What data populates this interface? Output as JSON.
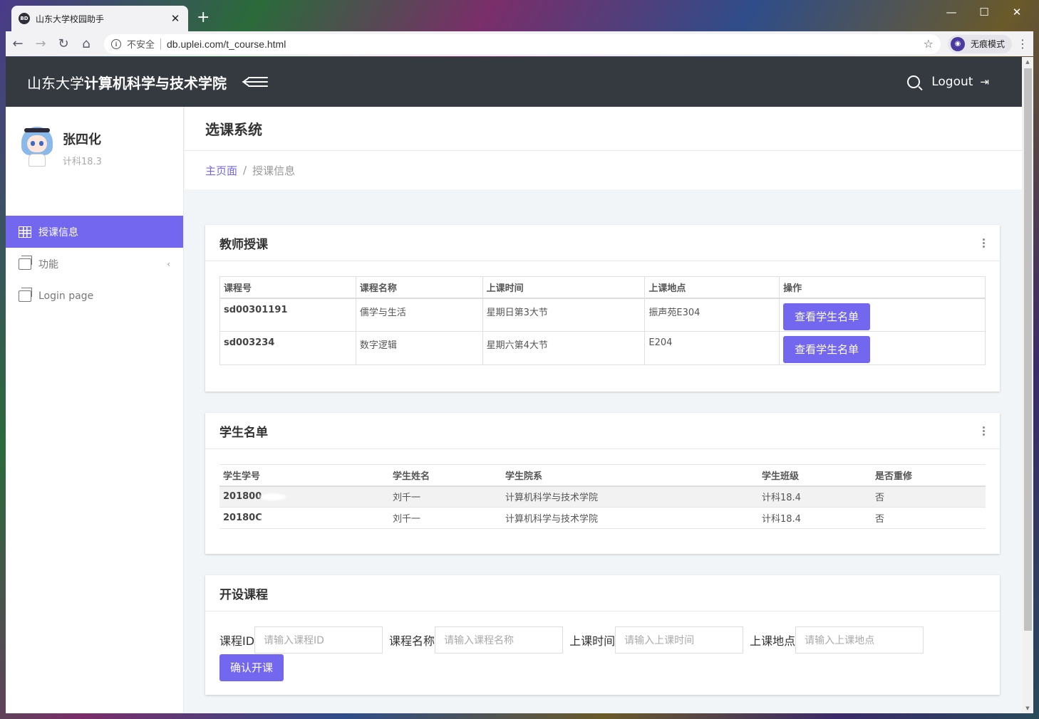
{
  "browser": {
    "tab_title": "山东大学校园助手",
    "favicon_text": "BD",
    "insecure_label": "不安全",
    "url": "db.uplei.com/t_course.html",
    "incognito_label": "无痕模式"
  },
  "topbar": {
    "brand_prefix": "山东大学",
    "brand_bold": "计算机科学与技术学院",
    "logout_label": "Logout"
  },
  "user": {
    "name": "张四化",
    "class": "计科18.3"
  },
  "sidebar": {
    "items": [
      {
        "label": "授课信息",
        "icon": "grid-icon",
        "active": true
      },
      {
        "label": "功能",
        "icon": "copy-icon",
        "has_submenu": true
      },
      {
        "label": "Login page",
        "icon": "copy-icon"
      }
    ]
  },
  "page": {
    "title": "选课系统",
    "breadcrumb_home": "主页面",
    "breadcrumb_current": "授课信息"
  },
  "teaching": {
    "title": "教师授课",
    "headers": [
      "课程号",
      "课程名称",
      "上课时间",
      "上课地点",
      "操作"
    ],
    "rows": [
      {
        "id": "sd00301191",
        "name": "儒学与生活",
        "time": "星期日第3大节",
        "place": "振声苑E304",
        "action": "查看学生名单"
      },
      {
        "id": "sd003234",
        "name": "数字逻辑",
        "time": "星期六第4大节",
        "place": "E204",
        "action": "查看学生名单"
      }
    ]
  },
  "students": {
    "title": "学生名单",
    "headers": [
      "学生学号",
      "学生姓名",
      "学生院系",
      "学生班级",
      "是否重修"
    ],
    "rows": [
      {
        "id": "201800",
        "name": "刘千一",
        "dept": "计算机科学与技术学院",
        "class": "计科18.4",
        "retake": "否"
      },
      {
        "id": "20180C",
        "name": "刘千一",
        "dept": "计算机科学与技术学院",
        "class": "计科18.4",
        "retake": "否"
      }
    ]
  },
  "open_course": {
    "title": "开设课程",
    "fields": [
      {
        "label": "课程ID",
        "placeholder": "请输入课程ID"
      },
      {
        "label": "课程名称",
        "placeholder": "请输入课程名称"
      },
      {
        "label": "上课时间",
        "placeholder": "请输入上课时间"
      },
      {
        "label": "上课地点",
        "placeholder": "请输入上课地点"
      }
    ],
    "submit_label": "确认开课"
  },
  "colors": {
    "accent": "#7367f0",
    "topbar": "#343a40",
    "background": "#f1f5f7"
  }
}
